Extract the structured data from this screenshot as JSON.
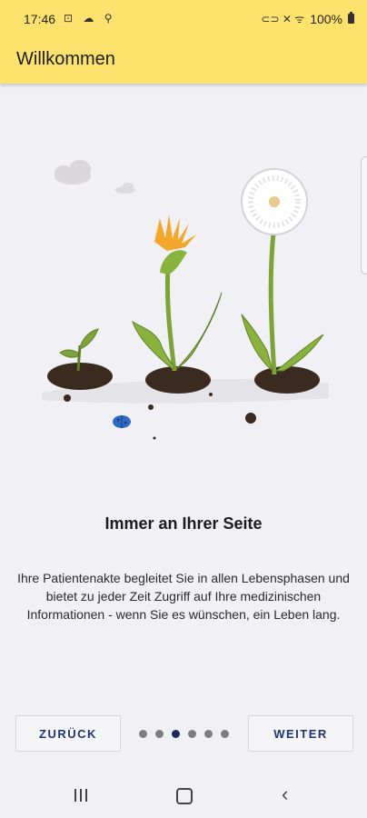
{
  "status": {
    "time": "17:46",
    "left_icons": "⊡ ☁ ⚲",
    "right_icons": "⊂⊃ ✕ ᯤ",
    "battery": "100%"
  },
  "app_bar": {
    "title": "Willkommen"
  },
  "content": {
    "heading": "Immer an Ihrer Seite",
    "body": "Ihre Patientenakte begleitet Sie in allen Lebensphasen und bietet zu jeder Zeit Zugriff auf Ihre medizinischen Informationen - wenn Sie es wünschen, ein Leben lang."
  },
  "navigation": {
    "back_label": "ZURÜCK",
    "next_label": "WEITER",
    "page_count": 6,
    "active_page": 3
  },
  "colors": {
    "accent": "#fde36d",
    "button_text": "#1f3470",
    "active_dot": "#1f2a5a",
    "inactive_dot": "#7d7d82"
  },
  "icons": [
    "recents-icon",
    "home-icon",
    "back-icon",
    "battery-icon",
    "wifi-icon",
    "mute-icon"
  ]
}
